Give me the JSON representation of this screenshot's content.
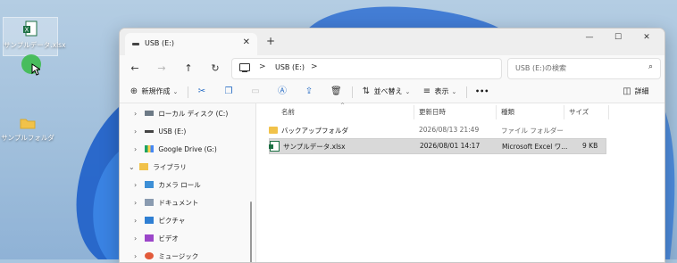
{
  "desktop": {
    "icons": [
      {
        "label": "サンプルデータ.xlsx",
        "selected": true
      },
      {
        "label": "サンプルフォルダ",
        "selected": false
      }
    ]
  },
  "window": {
    "tab_title": "USB (E:)",
    "tab_close": "✕",
    "new_tab": "+",
    "controls": {
      "minimize": "—",
      "maximize": "☐",
      "close": "✕"
    }
  },
  "address": {
    "separator": ">",
    "crumb": "USB (E:)",
    "search_placeholder": "USB (E:)の検索"
  },
  "toolbar": {
    "new_label": "新規作成",
    "sort_label": "並べ替え",
    "view_label": "表示",
    "more": "•••",
    "details_label": "詳細"
  },
  "navpane": {
    "items": [
      {
        "label": "ローカル ディスク (C:)",
        "expander": "›",
        "icon": "drive-icon"
      },
      {
        "label": "USB (E:)",
        "expander": "›",
        "icon": "usb-drive-icon"
      },
      {
        "label": "Google Drive (G:)",
        "expander": "›",
        "icon": "google-drive-icon"
      },
      {
        "label": "ライブラリ",
        "expander": "⌄",
        "icon": "library-folder-icon"
      },
      {
        "label": "カメラ ロール",
        "expander": "›",
        "icon": "camera-roll-icon"
      },
      {
        "label": "ドキュメント",
        "expander": "›",
        "icon": "documents-icon"
      },
      {
        "label": "ピクチャ",
        "expander": "›",
        "icon": "pictures-icon"
      },
      {
        "label": "ビデオ",
        "expander": "›",
        "icon": "videos-icon"
      },
      {
        "label": "ミュージック",
        "expander": "›",
        "icon": "music-icon"
      }
    ]
  },
  "filelist": {
    "columns": {
      "name": "名前",
      "date": "更新日時",
      "type": "種類",
      "size": "サイズ"
    },
    "sort_indicator": "^",
    "rows": [
      {
        "name": "バックアップフォルダ",
        "date": "2026/08/13 21:49",
        "type": "ファイル フォルダー",
        "size": "",
        "kind": "folder"
      },
      {
        "name": "サンプルデータ.xlsx",
        "date": "2026/08/01 14:17",
        "type": "Microsoft Excel ワ...",
        "size": "9 KB",
        "kind": "xlsx"
      }
    ]
  }
}
